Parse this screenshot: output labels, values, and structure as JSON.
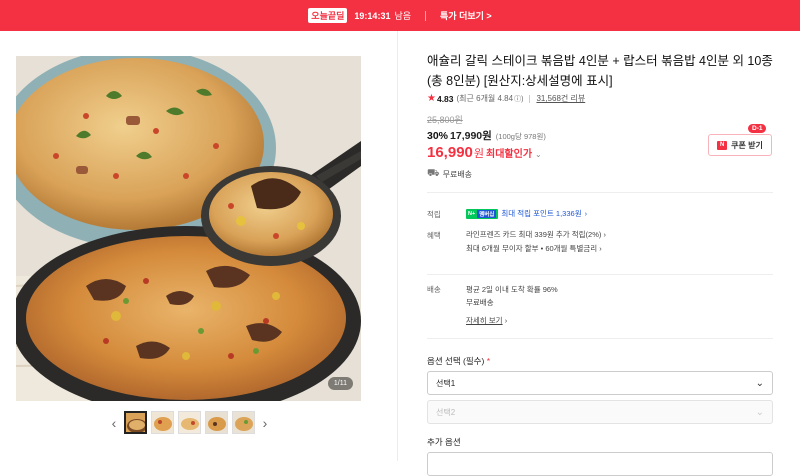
{
  "topbar": {
    "logo": "오늘끝딜",
    "timer": "19:14:31",
    "remaining": "남음",
    "more": "특가 더보기 >"
  },
  "gallery": {
    "counter": "1/11",
    "thumb_count": 5
  },
  "product": {
    "title": "애슐리 갈릭 스테이크 볶음밥 4인분 + 랍스터 볶음밥 4인분 외 10종 (총 8인분) [원산지:상세설명에 표시]",
    "rating": {
      "star": "★",
      "score": "4.83",
      "recent": "(최근 6개월 4.84",
      "reviews": "31,568건 리뷰"
    },
    "original_price": "25,800원",
    "sale": {
      "percent": "30%",
      "price": "17,990원",
      "unit_price": "(100g당 978원)"
    },
    "best": {
      "price": "16,990",
      "won": "원",
      "label": "최대할인가"
    },
    "coupon": {
      "badge": "D-1",
      "icon_text": "N",
      "label": "쿠폰 받기"
    },
    "shipping_label": "무료배송"
  },
  "benefits": {
    "point": {
      "label": "적립",
      "npay": "N+",
      "member": "멤버십",
      "text": "최대 적립 포인트 1,336원"
    },
    "perks": {
      "label": "혜택",
      "line1": "라인프렌즈 카드 최대 339원 추가 적립(2%)",
      "line2": "최대 6개월 무이자 할부 • 60개월 특별금리"
    }
  },
  "delivery": {
    "label": "배송",
    "line1": "평균 2일 이내 도착 확률 96%",
    "line2": "무료배송",
    "detail_link": "자세히 보기"
  },
  "options": {
    "label": "옵션 선택 (필수)",
    "required_mark": "*",
    "select1": "선택1",
    "select2": "선택2",
    "additional_label": "추가 옵션"
  },
  "colors": {
    "accent": "#f43142",
    "point_blue": "#1e57d6",
    "npay_green": "#03c75a"
  }
}
